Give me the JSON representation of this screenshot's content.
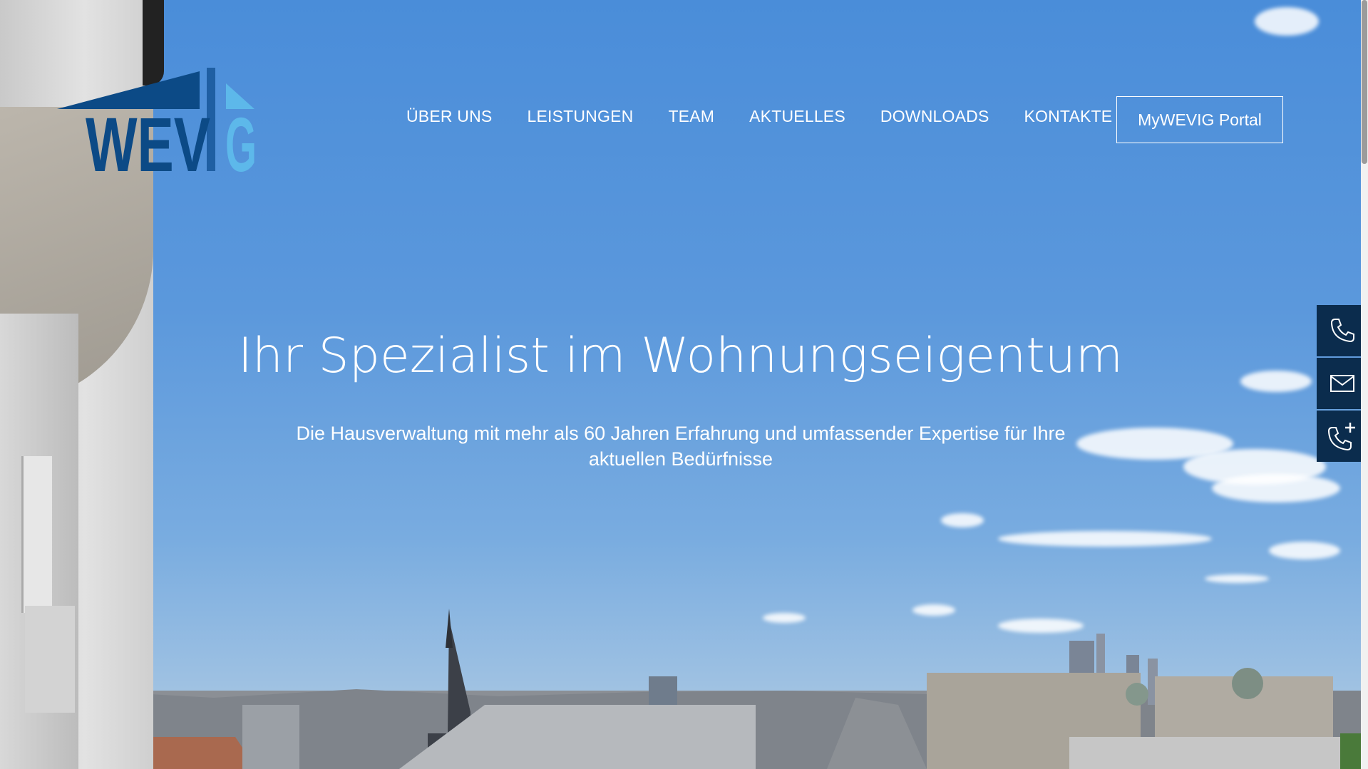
{
  "brand": {
    "logo_alt": "WEVIG",
    "colors": {
      "dark_blue": "#0c4a86",
      "mid_blue": "#1f5fa3",
      "light_blue": "#5db8ea",
      "widget_bg": "#0b2c4d"
    }
  },
  "nav": {
    "items": [
      {
        "label": "ÜBER UNS"
      },
      {
        "label": "LEISTUNGEN"
      },
      {
        "label": "TEAM"
      },
      {
        "label": "AKTUELLES"
      },
      {
        "label": "DOWNLOADS"
      },
      {
        "label": "KONTAKTE"
      }
    ],
    "portal_label": "MyWEVIG Portal"
  },
  "hero": {
    "headline": "Ihr Spezialist im Wohnungseigentum",
    "subtext": "Die Hausverwaltung mit mehr als 60 Jahren Erfahrung und umfassender Expertise für Ihre aktuellen Bedürfnisse"
  },
  "side_widget": {
    "icons": [
      "phone-icon",
      "mail-icon",
      "phone-plus-icon"
    ]
  }
}
